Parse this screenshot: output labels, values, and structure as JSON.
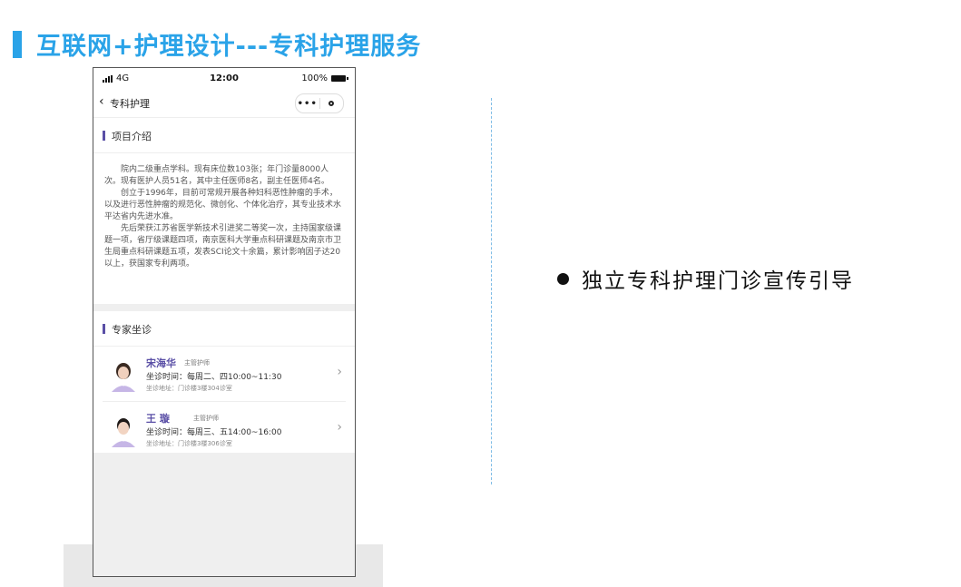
{
  "slide": {
    "title": "互联网+护理设计---专科护理服务",
    "accent_color": "#2aa3e8",
    "bullet": "独立专科护理门诊宣传引导"
  },
  "phone": {
    "status": {
      "network": "4G",
      "time": "12:00",
      "battery": "100%"
    },
    "nav": {
      "back_icon": "chevron-left-icon",
      "title": "专科护理",
      "more": "•••"
    },
    "intro": {
      "heading": "项目介绍",
      "paragraphs": [
        "院内二级重点学科。现有床位数103张；年门诊量8000人次。现有医护人员51名，其中主任医师8名，副主任医师4名。",
        "创立于1996年，目前可常规开展各种妇科恶性肿瘤的手术，以及进行恶性肿瘤的规范化、微创化、个体化治疗，其专业技术水平达省内先进水准。",
        "先后荣获江苏省医学新技术引进奖二等奖一次，主持国家级课题一项，省厅级课题四项，南京医科大学重点科研课题及南京市卫生局重点科研课题五项，发表SCI论文十余篇，累计影响因子达20以上，获国家专利两项。"
      ]
    },
    "experts": {
      "heading": "专家坐诊",
      "items": [
        {
          "name": "宋海华",
          "title": "主管护师",
          "time": "坐诊时间：每周二、四10:00~11:30",
          "address": "坐诊地址：门诊楼3楼304诊室"
        },
        {
          "name": "王 璇",
          "title": "主管护师",
          "time": "坐诊时间：每周三、五14:00~16:00",
          "address": "坐诊地址：门诊楼3楼306诊室"
        }
      ]
    },
    "brand_color": "#5a4fa6"
  }
}
